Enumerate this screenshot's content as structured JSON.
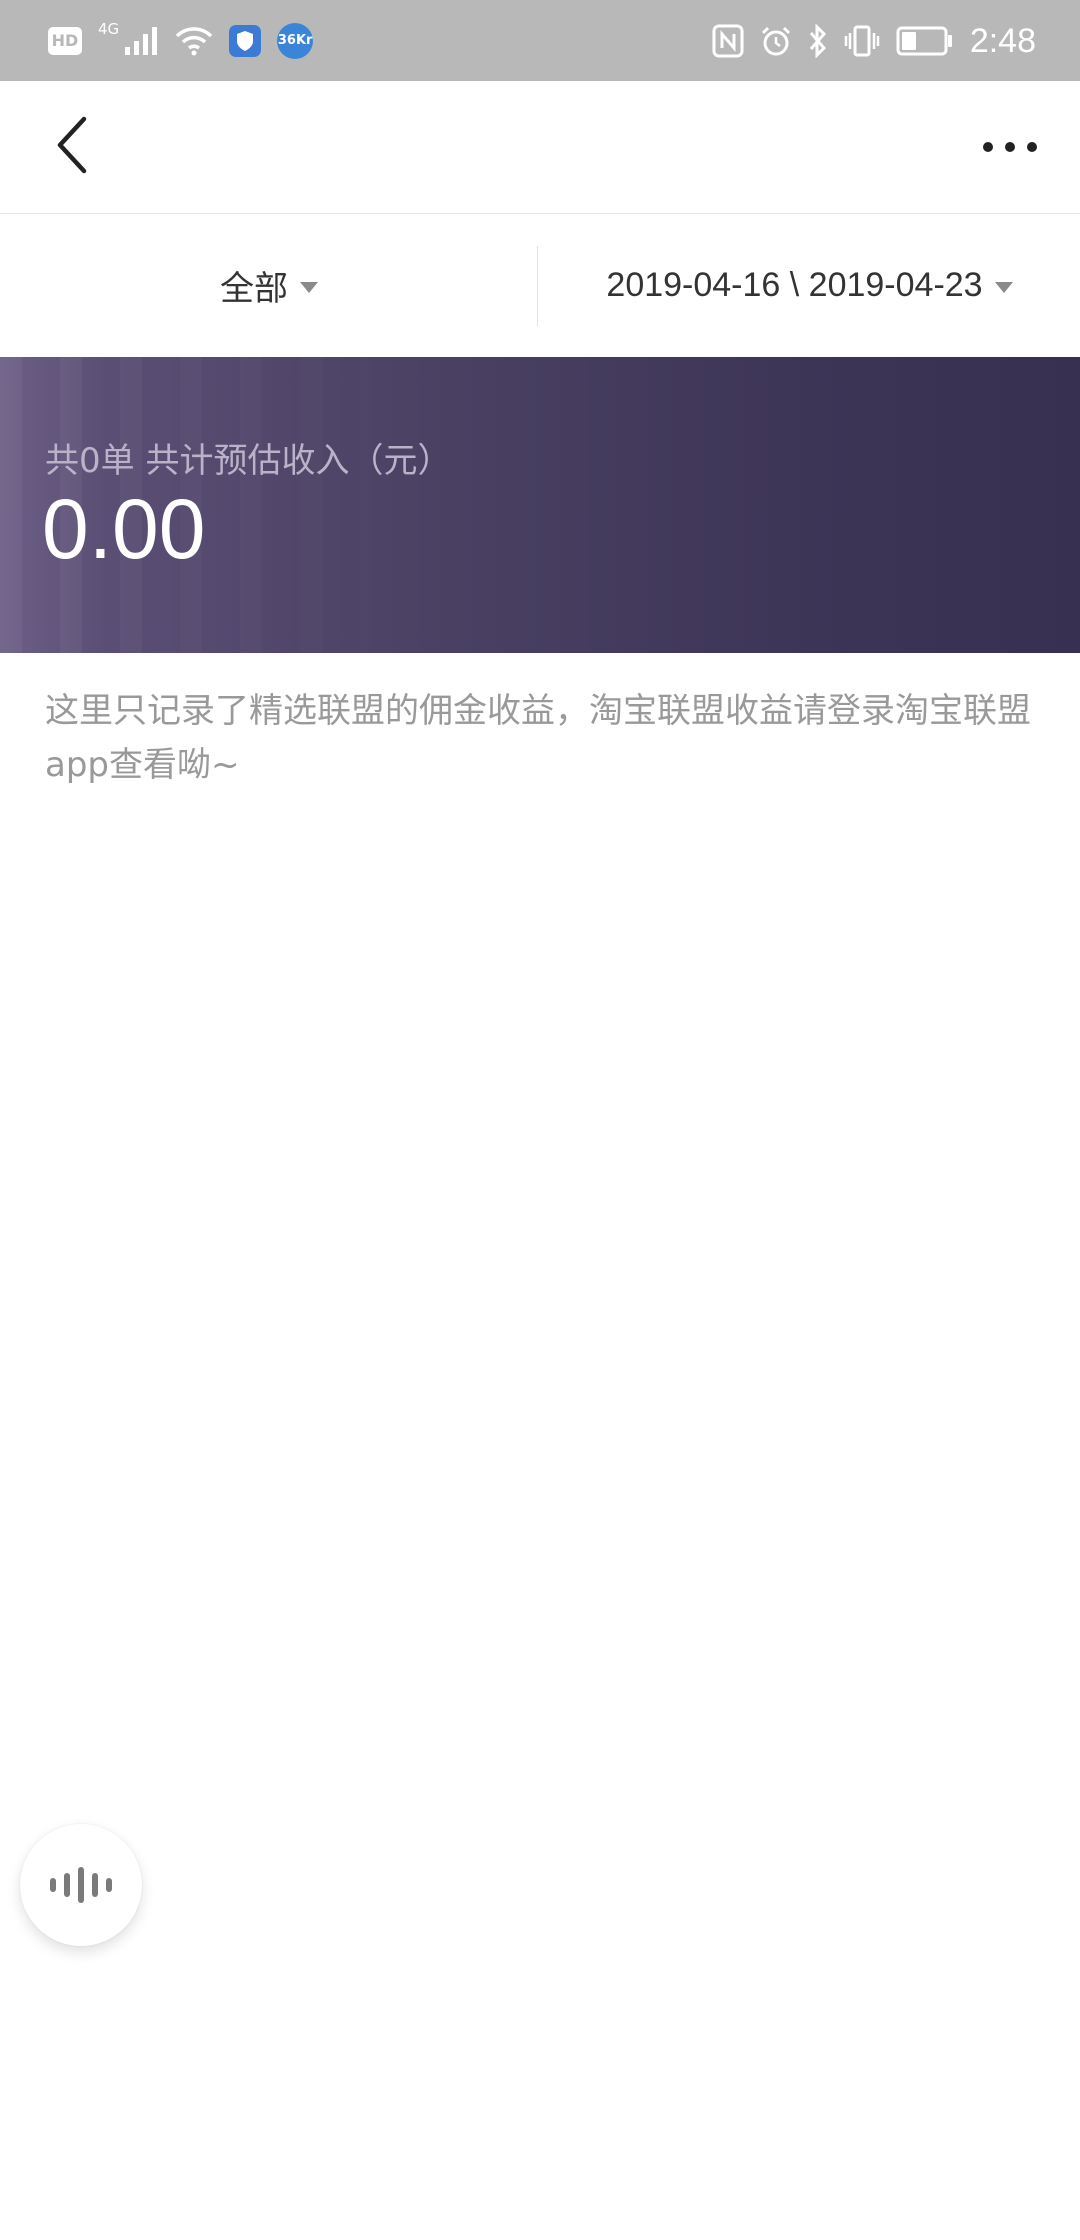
{
  "status_bar": {
    "network_badge": "HD",
    "network_type": "4G",
    "app_badge": "36Kr",
    "time": "2:48"
  },
  "nav": {
    "back_icon": "chevron-left-icon",
    "more_icon": "more-horizontal-icon"
  },
  "filters": {
    "type_label": "全部",
    "date_range": "2019-04-16 \\ 2019-04-23"
  },
  "summary": {
    "label": "共0单 共计预估收入（元）",
    "amount": "0.00"
  },
  "notice": "这里只记录了精选联盟的佣金收益，淘宝联盟收益请登录淘宝联盟app查看呦~",
  "colors": {
    "status_bar": "#b8b8b8",
    "banner_start": "#6d5f86",
    "banner_end": "#383050",
    "notice_text": "#999999"
  }
}
